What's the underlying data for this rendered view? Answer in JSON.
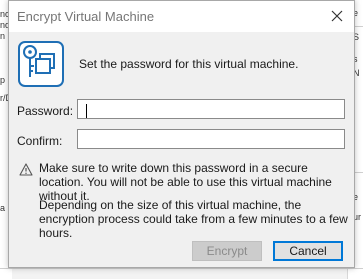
{
  "background": {
    "left_fragments": [
      "nc",
      "ndo",
      "n",
      "p",
      "r/D",
      "a"
    ],
    "right_fragments": [
      "e",
      "S",
      "s",
      "N",
      "e",
      "ur"
    ]
  },
  "dialog": {
    "title": "Encrypt Virtual Machine",
    "close_icon": "close-icon",
    "header_icon": "key-lock-icon",
    "header_text": "Set the password for this virtual machine.",
    "password_label": "Password:",
    "password_value": "",
    "confirm_label": "Confirm:",
    "confirm_value": "",
    "warning_icon": "warning-triangle-icon",
    "warning_text": "Make sure to write down this password in a secure location. You will not be able to use this virtual machine without it.",
    "info_text": "Depending on the size of this virtual machine, the encryption process could take from a few minutes to a few hours.",
    "encrypt_label": "Encrypt",
    "cancel_label": "Cancel"
  },
  "colors": {
    "accent": "#0078d7",
    "icon_blue": "#1f6fb5",
    "disabled_button": "#cccccc"
  }
}
